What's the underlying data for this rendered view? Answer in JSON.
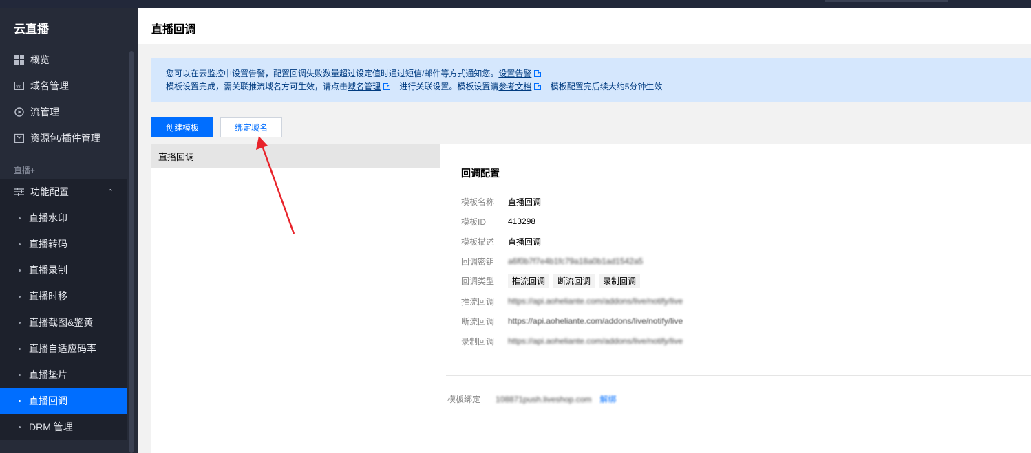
{
  "app": {
    "title": "云直播"
  },
  "sidebar": {
    "items": [
      {
        "label": "概览",
        "icon": "grid-icon"
      },
      {
        "label": "域名管理",
        "icon": "domain-icon"
      },
      {
        "label": "流管理",
        "icon": "play-circle-icon"
      },
      {
        "label": "资源包/插件管理",
        "icon": "package-icon"
      }
    ],
    "group_label": "直播+",
    "feature_config": {
      "label": "功能配置",
      "icon": "sliders-icon",
      "expanded": true
    },
    "sub_items": [
      {
        "label": "直播水印",
        "active": false
      },
      {
        "label": "直播转码",
        "active": false
      },
      {
        "label": "直播录制",
        "active": false
      },
      {
        "label": "直播时移",
        "active": false
      },
      {
        "label": "直播截图&鉴黄",
        "active": false
      },
      {
        "label": "直播自适应码率",
        "active": false
      },
      {
        "label": "直播垫片",
        "active": false
      },
      {
        "label": "直播回调",
        "active": true
      },
      {
        "label": "DRM 管理",
        "active": false
      }
    ]
  },
  "header": {
    "title": "直播回调"
  },
  "notice": {
    "line1_text": "您可以在云监控中设置告警，配置回调失败数量超过设定值时通过短信/邮件等方式通知您。",
    "line1_link": "设置告警",
    "line2_text_a": "模板设置完成，需关联推流域名方可生效，请点击",
    "line2_link_a": "域名管理",
    "line2_text_b": "进行关联设置。模板设置请",
    "line2_link_b": "参考文档",
    "line2_text_c": "模板配置完后续大约5分钟生效"
  },
  "toolbar": {
    "create_label": "创建模板",
    "bind_label": "绑定域名"
  },
  "template_list": [
    {
      "name": "直播回调"
    }
  ],
  "detail": {
    "title": "回调配置",
    "fields": [
      {
        "label": "模板名称",
        "value": "直播回调"
      },
      {
        "label": "模板ID",
        "value": "413298"
      },
      {
        "label": "模板描述",
        "value": "直播回调"
      },
      {
        "label": "回调密钥",
        "value": "a6f0b7f7e4b1fc79a18a0b1ad1542a5"
      },
      {
        "label": "回调类型",
        "tags": [
          "推流回调",
          "断流回调",
          "录制回调"
        ]
      },
      {
        "label": "推流回调",
        "value": "https://api.aoheliante.com/addons/live/notify/live"
      },
      {
        "label": "断流回调",
        "value": "https://api.aoheliante.com/addons/live/notify/live"
      },
      {
        "label": "录制回调",
        "value": "https://api.aoheliante.com/addons/live/notify/live"
      }
    ],
    "binding": {
      "label": "模板绑定",
      "value": "108871push.liveshop.com",
      "action": "解绑"
    }
  },
  "colors": {
    "accent": "#006eff",
    "sidebar_bg": "#262b38",
    "notice_bg": "#d5e7fd",
    "annotation_arrow": "#e8232a"
  }
}
